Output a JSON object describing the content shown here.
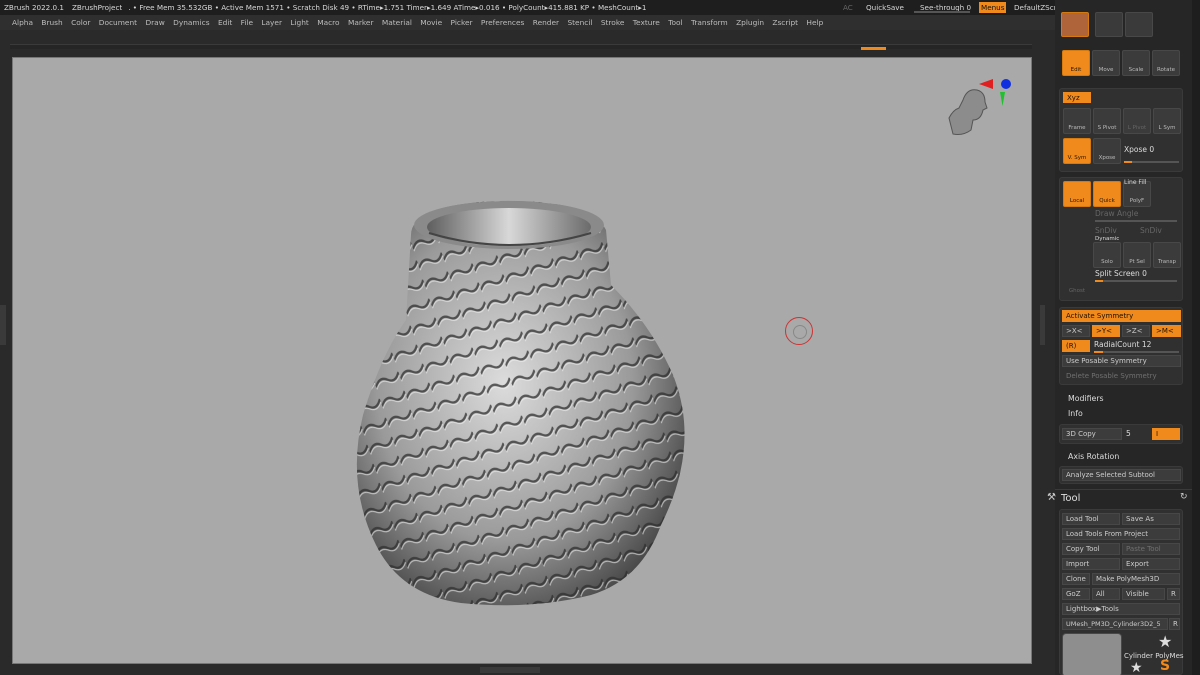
{
  "titlebar": {
    "app": "ZBrush 2022.0.1",
    "project": "ZBrushProject",
    "stats": ". • Free Mem 35.532GB • Active Mem 1571 • Scratch Disk 49 •  RTime▸1.751 Timer▸1.649 ATime▸0.016 • PolyCount▸415.881 KP  • MeshCount▸1",
    "ac": "AC",
    "quicksave": "QuickSave",
    "see_through": "See-through  0",
    "see_through_value": 0,
    "menus": "Menus",
    "default_script": "DefaultZScript"
  },
  "menubar": [
    "Alpha",
    "Brush",
    "Color",
    "Document",
    "Draw",
    "Dynamics",
    "Edit",
    "File",
    "Layer",
    "Light",
    "Macro",
    "Marker",
    "Material",
    "Movie",
    "Picker",
    "Preferences",
    "Render",
    "Stencil",
    "Stroke",
    "Texture",
    "Tool",
    "Transform",
    "Zplugin",
    "Zscript",
    "Help"
  ],
  "right_panel": {
    "edit_tools": [
      "Edit",
      "Move",
      "Scale",
      "Rotate"
    ],
    "xyz": "Xyz",
    "frame": "Frame",
    "spivot": "S Pivot",
    "lpivot": "L Pivot",
    "lsym": "L Sym",
    "vsym": "V. Sym",
    "xpose": "Xpose",
    "xpose_label": "Xpose 0",
    "local": "Local",
    "quick": "Quick",
    "polyf": "PolyF",
    "line_fill": "Line Fill",
    "draw_angle": "Draw Angle",
    "sndiv": "SnDiv",
    "sndiv2": "SnDiv",
    "dynamic": "Dynamic",
    "solo": "Solo",
    "ptsel": "Pt Sel",
    "transp": "Transp",
    "ghost": "Ghost",
    "split_screen": "Split Screen 0",
    "activate_symmetry": "Activate Symmetry",
    "sym_x": ">X<",
    "sym_y": ">Y<",
    "sym_z": ">Z<",
    "sym_m": ">M<",
    "r_btn": "(R)",
    "radial_count": "RadialCount 12",
    "use_posable": "Use Posable Symmetry",
    "delete_posable": "Delete Posable Symmetry",
    "modifiers": "Modifiers",
    "info": "Info",
    "copy3d": "3D Copy",
    "copy3d_value": "5",
    "copy3d_btn": "I",
    "axis_rotation": "Axis Rotation",
    "analyze": "Analyze Selected Subtool"
  },
  "tool_palette": {
    "title": "Tool",
    "load_tool": "Load Tool",
    "save_as": "Save As",
    "load_from_project": "Load Tools From Project",
    "copy_tool": "Copy Tool",
    "paste_tool": "Paste Tool",
    "import": "Import",
    "export": "Export",
    "clone": "Clone",
    "make_polymesh": "Make PolyMesh3D",
    "goz": "GoZ",
    "all": "All",
    "visible": "Visible",
    "r": "R",
    "lightbox_tools": "Lightbox▶Tools",
    "current_tool": "UMesh_PM3D_Cylinder3D2_5",
    "current_tool_r": "R",
    "thumb_labels": "Cylinder PolyMes"
  },
  "colors": {
    "accent": "#f08a1c",
    "canvas": "#a9a9a9",
    "panel": "#262626"
  }
}
